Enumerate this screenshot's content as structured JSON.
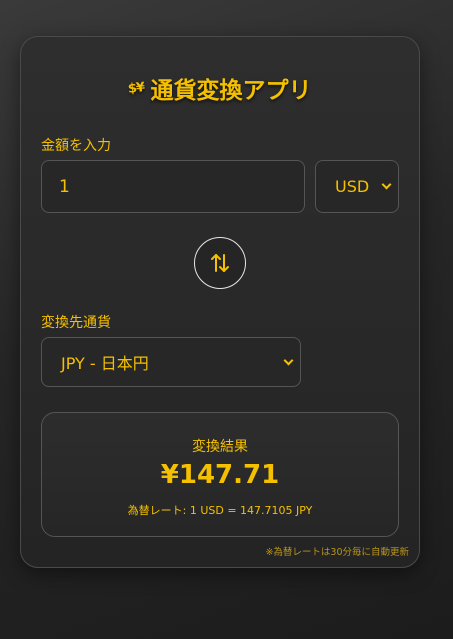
{
  "app": {
    "title": "通貨変換アプリ",
    "logo_text": "$¥"
  },
  "amount": {
    "label": "金額を入力",
    "value": "1"
  },
  "from_currency": {
    "selected": "USD"
  },
  "swap": {
    "icon": "swap-vertical-arrows"
  },
  "to_currency": {
    "label": "変換先通貨",
    "selected": "JPY - 日本円"
  },
  "result": {
    "label": "変換結果",
    "value": "¥147.71",
    "rate": "為替レート: 1 USD = 147.7105 JPY"
  },
  "footer_note": "※為替レートは30分毎に自動更新",
  "colors": {
    "accent": "#f5c000",
    "background": "#2a2a2a",
    "card": "#2b2b2b",
    "border": "#555555"
  }
}
